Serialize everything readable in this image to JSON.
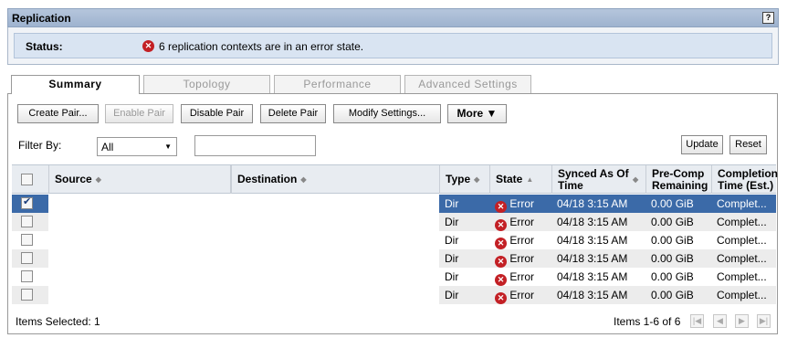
{
  "header": {
    "title": "Replication",
    "help_label": "?"
  },
  "status": {
    "label": "Status:",
    "message": "6 replication contexts are in an error state."
  },
  "tabs": [
    {
      "label": "Summary",
      "active": true
    },
    {
      "label": "Topology",
      "active": false
    },
    {
      "label": "Performance",
      "active": false
    },
    {
      "label": "Advanced Settings",
      "active": false
    }
  ],
  "toolbar": {
    "create_pair": "Create Pair...",
    "enable_pair": "Enable Pair",
    "disable_pair": "Disable Pair",
    "delete_pair": "Delete Pair",
    "modify_settings": "Modify Settings...",
    "more": "More ▼"
  },
  "filter": {
    "label": "Filter By:",
    "selected": "All",
    "text_value": "",
    "update": "Update",
    "reset": "Reset"
  },
  "table": {
    "columns": [
      "Source",
      "Destination",
      "Type",
      "State",
      "Synced As Of Time",
      "Pre-Comp Remaining",
      "Completion Time (Est.)"
    ],
    "rows": [
      {
        "checked": true,
        "source": "",
        "destination": "",
        "type": "Dir",
        "state": "Error",
        "synced": "04/18 3:15 AM",
        "remaining": "0.00 GiB",
        "completion": "Complet..."
      },
      {
        "checked": false,
        "source": "",
        "destination": "",
        "type": "Dir",
        "state": "Error",
        "synced": "04/18 3:15 AM",
        "remaining": "0.00 GiB",
        "completion": "Complet..."
      },
      {
        "checked": false,
        "source": "",
        "destination": "",
        "type": "Dir",
        "state": "Error",
        "synced": "04/18 3:15 AM",
        "remaining": "0.00 GiB",
        "completion": "Complet..."
      },
      {
        "checked": false,
        "source": "",
        "destination": "",
        "type": "Dir",
        "state": "Error",
        "synced": "04/18 3:15 AM",
        "remaining": "0.00 GiB",
        "completion": "Complet..."
      },
      {
        "checked": false,
        "source": "",
        "destination": "",
        "type": "Dir",
        "state": "Error",
        "synced": "04/18 3:15 AM",
        "remaining": "0.00 GiB",
        "completion": "Complet..."
      },
      {
        "checked": false,
        "source": "",
        "destination": "",
        "type": "Dir",
        "state": "Error",
        "synced": "04/18 3:15 AM",
        "remaining": "0.00 GiB",
        "completion": "Complet..."
      }
    ]
  },
  "footer": {
    "items_selected": "Items Selected: 1",
    "page_info": "Items 1-6 of 6"
  },
  "colors": {
    "error": "#c32025",
    "selection": "#3b6aa8",
    "header_bar": "#b5c6dc"
  }
}
